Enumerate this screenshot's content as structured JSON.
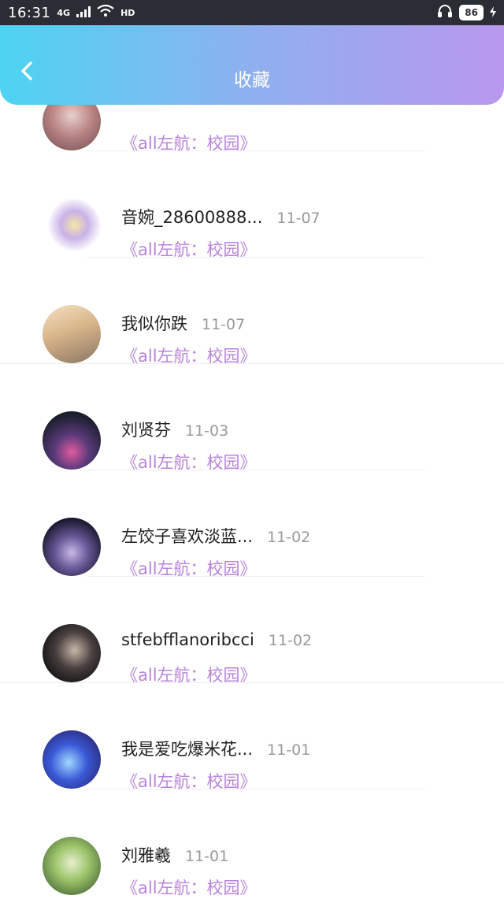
{
  "status_bar": {
    "time": "16:31",
    "network": "4G",
    "hd": "HD",
    "battery": "86"
  },
  "header": {
    "title": "收藏",
    "back_icon": "chevron-left-icon"
  },
  "colors": {
    "header_gradient_start": "#4cd4f2",
    "header_gradient_end": "#b897ec",
    "work_title": "#b983de",
    "name_text": "#222222",
    "date_text": "#9a9a9a"
  },
  "favorites": [
    {
      "name": "",
      "date": "",
      "work": "《all左航：校园》"
    },
    {
      "name": "音婉_28600888...",
      "date": "11-07",
      "work": "《all左航：校园》"
    },
    {
      "name": "我似你跌",
      "date": "11-07",
      "work": "《all左航：校园》"
    },
    {
      "name": "刘贤芬",
      "date": "11-03",
      "work": "《all左航：校园》"
    },
    {
      "name": "左饺子喜欢淡蓝...",
      "date": "11-02",
      "work": "《all左航：校园》"
    },
    {
      "name": "stfebfflanoribcci",
      "date": "11-02",
      "work": "《all左航：校园》"
    },
    {
      "name": "我是爱吃爆米花...",
      "date": "11-01",
      "work": "《all左航：校园》"
    },
    {
      "name": "刘雅羲",
      "date": "11-01",
      "work": "《all左航：校园》"
    }
  ]
}
